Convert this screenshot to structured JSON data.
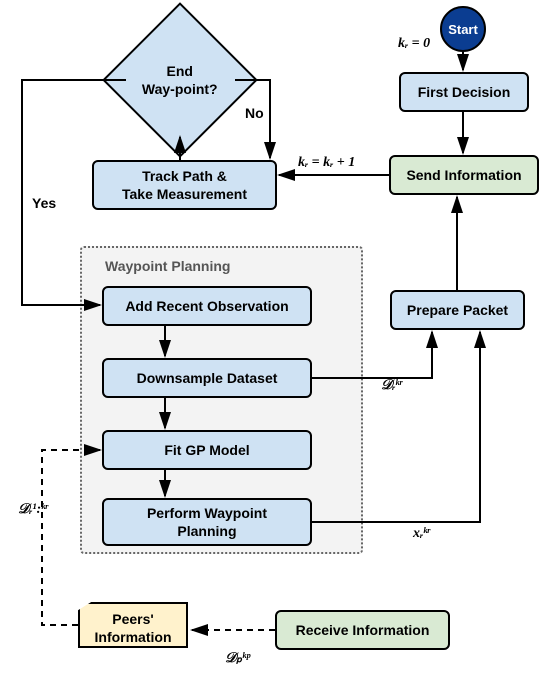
{
  "diagram": {
    "start": "Start",
    "init_kr": "kᵣ = 0",
    "first_decision": "First Decision",
    "send_info": "Send Information",
    "inc_kr": "kᵣ = kᵣ + 1",
    "track_path": "Track Path &\nTake Measurement",
    "end_wp": "End\nWay-point?",
    "no": "No",
    "yes": "Yes",
    "panel_label": "Waypoint Planning",
    "add_obs": "Add Recent Observation",
    "downsample": "Downsample Dataset",
    "fit_gp": "Fit GP Model",
    "perform_wp": "Perform Waypoint\nPlanning",
    "prepare_packet": "Prepare Packet",
    "peers_info": "Peers'\nInformation",
    "receive_info": "Receive Information",
    "d_r_kr": "𝒟ᵣᵏʳ",
    "x_r_kr": "xᵣᵏʳ",
    "d_r_1kr": "𝒟ᵣ¹:ᵏʳ",
    "d_p_kp": "𝒟ₚᵏᵖ"
  }
}
